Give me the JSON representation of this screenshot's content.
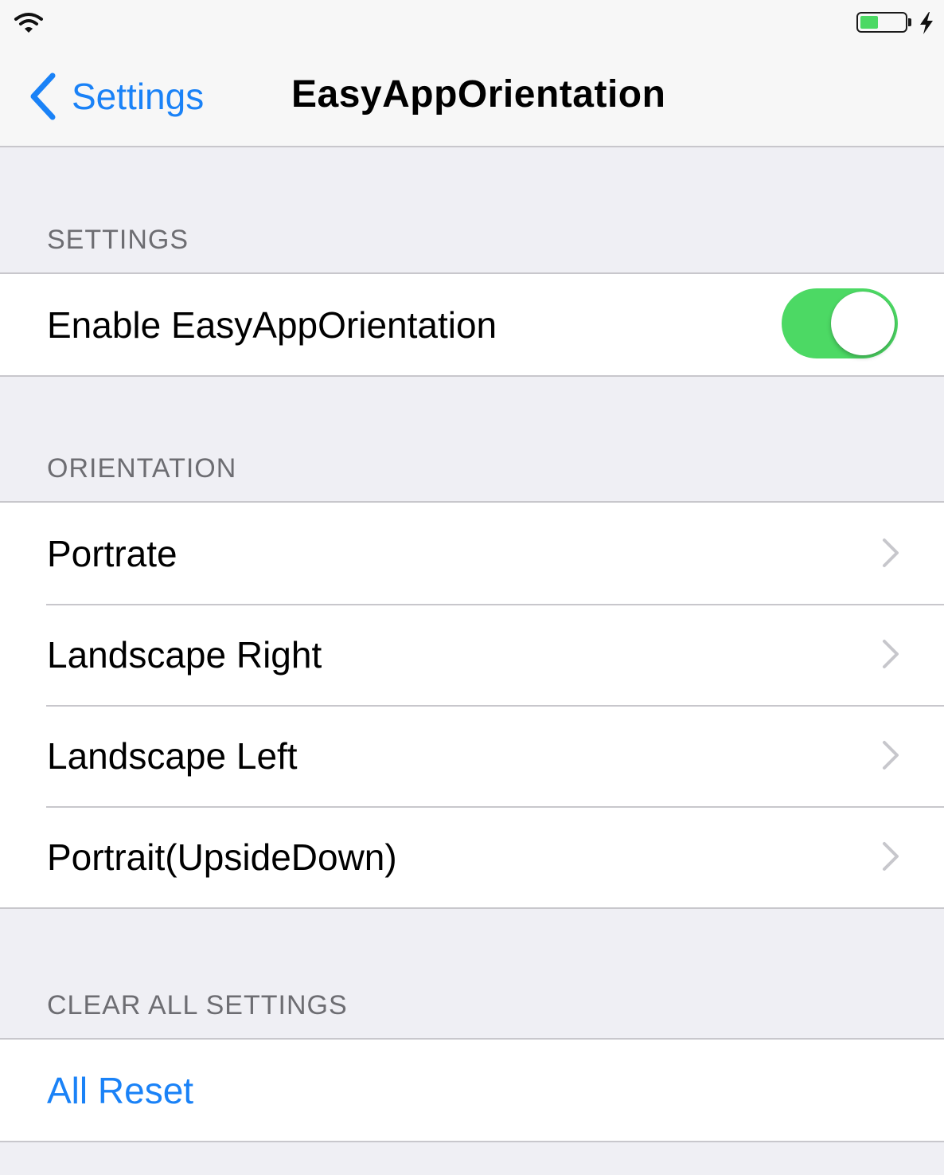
{
  "status_bar": {
    "wifi_icon": "wifi-icon",
    "battery_icon": "battery-icon",
    "charging_icon": "charging-bolt-icon",
    "battery_level": 0.4,
    "battery_color": "#4cd964"
  },
  "nav": {
    "back_label": "Settings",
    "title": "EasyAppOrientation",
    "accent_color": "#1a82f7"
  },
  "sections": {
    "settings": {
      "header": "SETTINGS",
      "enable_label": "Enable EasyAppOrientation",
      "enable_on": true
    },
    "orientation": {
      "header": "ORIENTATION",
      "items": [
        {
          "label": "Portrate"
        },
        {
          "label": "Landscape Right"
        },
        {
          "label": "Landscape Left"
        },
        {
          "label": "Portrait(UpsideDown)"
        }
      ]
    },
    "clear": {
      "header": "CLEAR ALL SETTINGS",
      "reset_label": "All Reset"
    }
  }
}
